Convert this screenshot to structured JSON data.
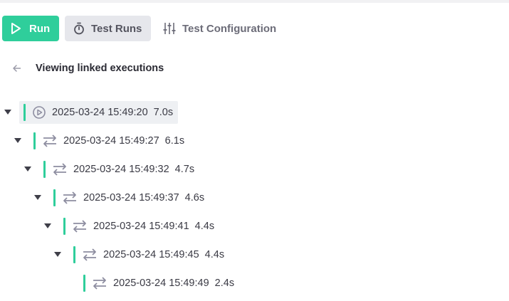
{
  "toolbar": {
    "run_label": "Run",
    "test_runs_label": "Test Runs",
    "test_config_label": "Test Configuration"
  },
  "header": {
    "title": "Viewing linked executions"
  },
  "colors": {
    "accent": "#2fce9b",
    "icon": "#8d8da0"
  },
  "tree": [
    {
      "timestamp": "2025-03-24 15:49:20",
      "duration": "7.0s",
      "icon": "play-circle-icon",
      "expanded": true,
      "selected": true
    },
    {
      "timestamp": "2025-03-24 15:49:27",
      "duration": "6.1s",
      "icon": "transfer-arrows-icon",
      "expanded": true
    },
    {
      "timestamp": "2025-03-24 15:49:32",
      "duration": "4.7s",
      "icon": "transfer-arrows-icon",
      "expanded": true
    },
    {
      "timestamp": "2025-03-24 15:49:37",
      "duration": "4.6s",
      "icon": "transfer-arrows-icon",
      "expanded": true
    },
    {
      "timestamp": "2025-03-24 15:49:41",
      "duration": "4.4s",
      "icon": "transfer-arrows-icon",
      "expanded": true
    },
    {
      "timestamp": "2025-03-24 15:49:45",
      "duration": "4.4s",
      "icon": "transfer-arrows-icon",
      "expanded": true
    },
    {
      "timestamp": "2025-03-24 15:49:49",
      "duration": "2.4s",
      "icon": "transfer-arrows-icon",
      "expanded": false
    }
  ]
}
